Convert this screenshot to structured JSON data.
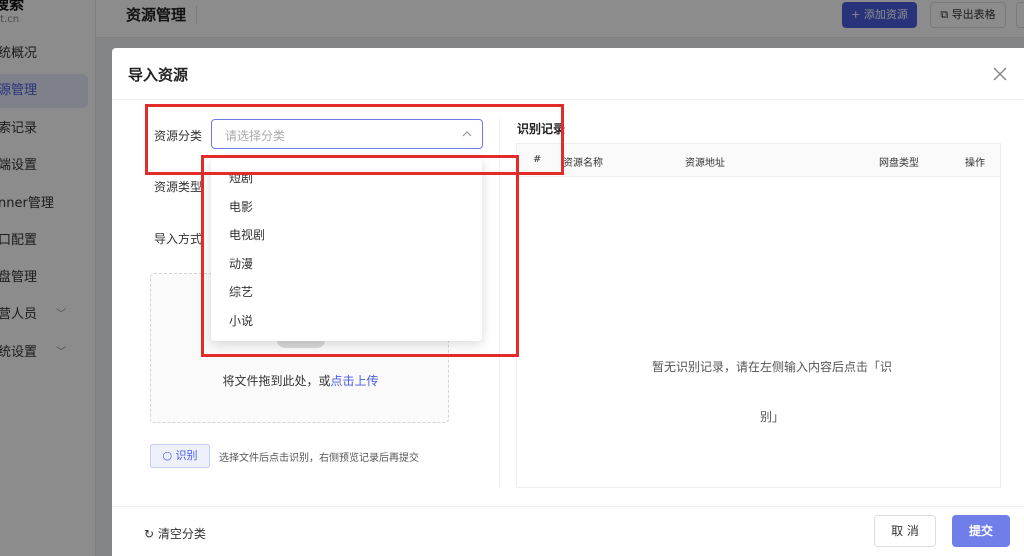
{
  "sidebar": {
    "logo_main": "搜索",
    "logo_sub": "ot.cn",
    "items": [
      {
        "label": "统概况"
      },
      {
        "label": "源管理"
      },
      {
        "label": "索记录"
      },
      {
        "label": "端设置"
      },
      {
        "label": "nner管理"
      },
      {
        "label": "口配置"
      },
      {
        "label": "盘管理"
      },
      {
        "label": "营人员"
      },
      {
        "label": "统设置"
      }
    ]
  },
  "topbar": {
    "title": "资源管理",
    "add_label": "+ 添加资源",
    "export_label": "⧉ 导出表格"
  },
  "modal": {
    "title": "导入资源",
    "form": {
      "category_label": "资源分类",
      "category_placeholder": "请选择分类",
      "type_label": "资源类型",
      "import_label": "导入方式",
      "upload_text": "将文件拖到此处，或",
      "upload_link": "点击上传",
      "recognize_label": "识别",
      "hint": "选择文件后点击识别，右侧预览记录后再提交"
    },
    "records": {
      "title": "识别记录",
      "columns": [
        "#",
        "资源名称",
        "资源地址",
        "网盘类型",
        "操作"
      ],
      "empty_line1": "暂无识别记录，请在左侧输入内容后点击「识",
      "empty_line2": "别」"
    },
    "footer": {
      "clear_label": "清空分类",
      "cancel_label": "取 消",
      "submit_label": "提交"
    },
    "dropdown": {
      "options": [
        "短剧",
        "电影",
        "电视剧",
        "动漫",
        "综艺",
        "小说"
      ]
    }
  },
  "colors": {
    "accent": "#4a5de0",
    "annotation": "#e22b2b"
  }
}
